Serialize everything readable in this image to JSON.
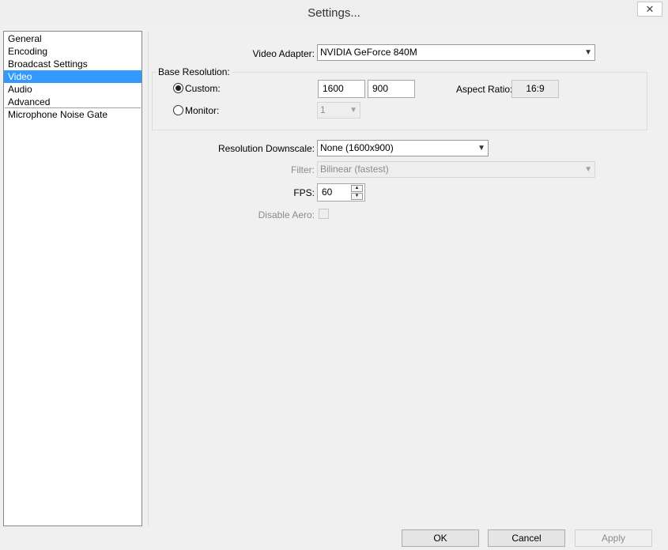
{
  "window": {
    "title": "Settings...",
    "close_glyph": "✕"
  },
  "sidebar": {
    "items": [
      {
        "label": "General",
        "selected": false
      },
      {
        "label": "Encoding",
        "selected": false
      },
      {
        "label": "Broadcast Settings",
        "selected": false
      },
      {
        "label": "Video",
        "selected": true
      },
      {
        "label": "Audio",
        "selected": false
      },
      {
        "label": "Advanced",
        "selected": false
      },
      {
        "label": "Microphone Noise Gate",
        "selected": false
      }
    ]
  },
  "video": {
    "adapter_label": "Video Adapter:",
    "adapter_value": "NVIDIA GeForce 840M",
    "base_resolution": {
      "group_label": "Base Resolution:",
      "custom_label": "Custom:",
      "custom_selected": true,
      "width": "1600",
      "height": "900",
      "aspect_label": "Aspect Ratio:",
      "aspect_value": "16:9",
      "monitor_label": "Monitor:",
      "monitor_value": "1"
    },
    "downscale_label": "Resolution Downscale:",
    "downscale_value": "None  (1600x900)",
    "filter_label": "Filter:",
    "filter_value": "Bilinear (fastest)",
    "fps_label": "FPS:",
    "fps_value": "60",
    "disable_aero_label": "Disable Aero:",
    "disable_aero_checked": false
  },
  "buttons": {
    "ok": "OK",
    "cancel": "Cancel",
    "apply": "Apply"
  },
  "colors": {
    "selection": "#3399ff",
    "title_strip": "#1f3a66"
  }
}
